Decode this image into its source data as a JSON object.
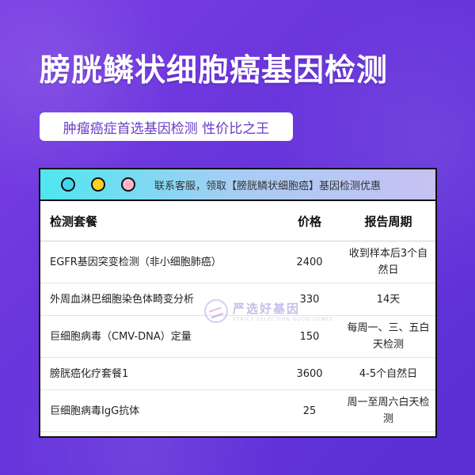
{
  "title": "膀胱鳞状细胞癌基因检测",
  "subtitle": "肿瘤癌症首选基因检测 性价比之王",
  "window": {
    "bar_text": "联系客服，领取【膀胱鳞状细胞癌】基因检测优惠",
    "dot_colors": [
      "#44d6ef",
      "#ffd21e",
      "#ffb7c7"
    ]
  },
  "table": {
    "headers": [
      "检测套餐",
      "价格",
      "报告周期"
    ],
    "rows": [
      {
        "name": "EGFR基因突变检测（非小细胞肺癌）",
        "price": "2400",
        "period": "收到样本后3个自然日"
      },
      {
        "name": "外周血淋巴细胞染色体畸变分析",
        "price": "330",
        "period": "14天"
      },
      {
        "name": "巨细胞病毒（CMV-DNA）定量",
        "price": "150",
        "period": "每周一、三、五白天检测"
      },
      {
        "name": "膀胱癌化疗套餐1",
        "price": "3600",
        "period": "4-5个自然日"
      },
      {
        "name": "巨细胞病毒IgG抗体",
        "price": "25",
        "period": "周一至周六白天检测"
      }
    ]
  },
  "watermark": {
    "name": "严选好基因",
    "tagline": "STRICT SELECTION GOOD GENES"
  },
  "colors": {
    "background": "#6a35dc",
    "accent_text": "#6a3cc8"
  }
}
